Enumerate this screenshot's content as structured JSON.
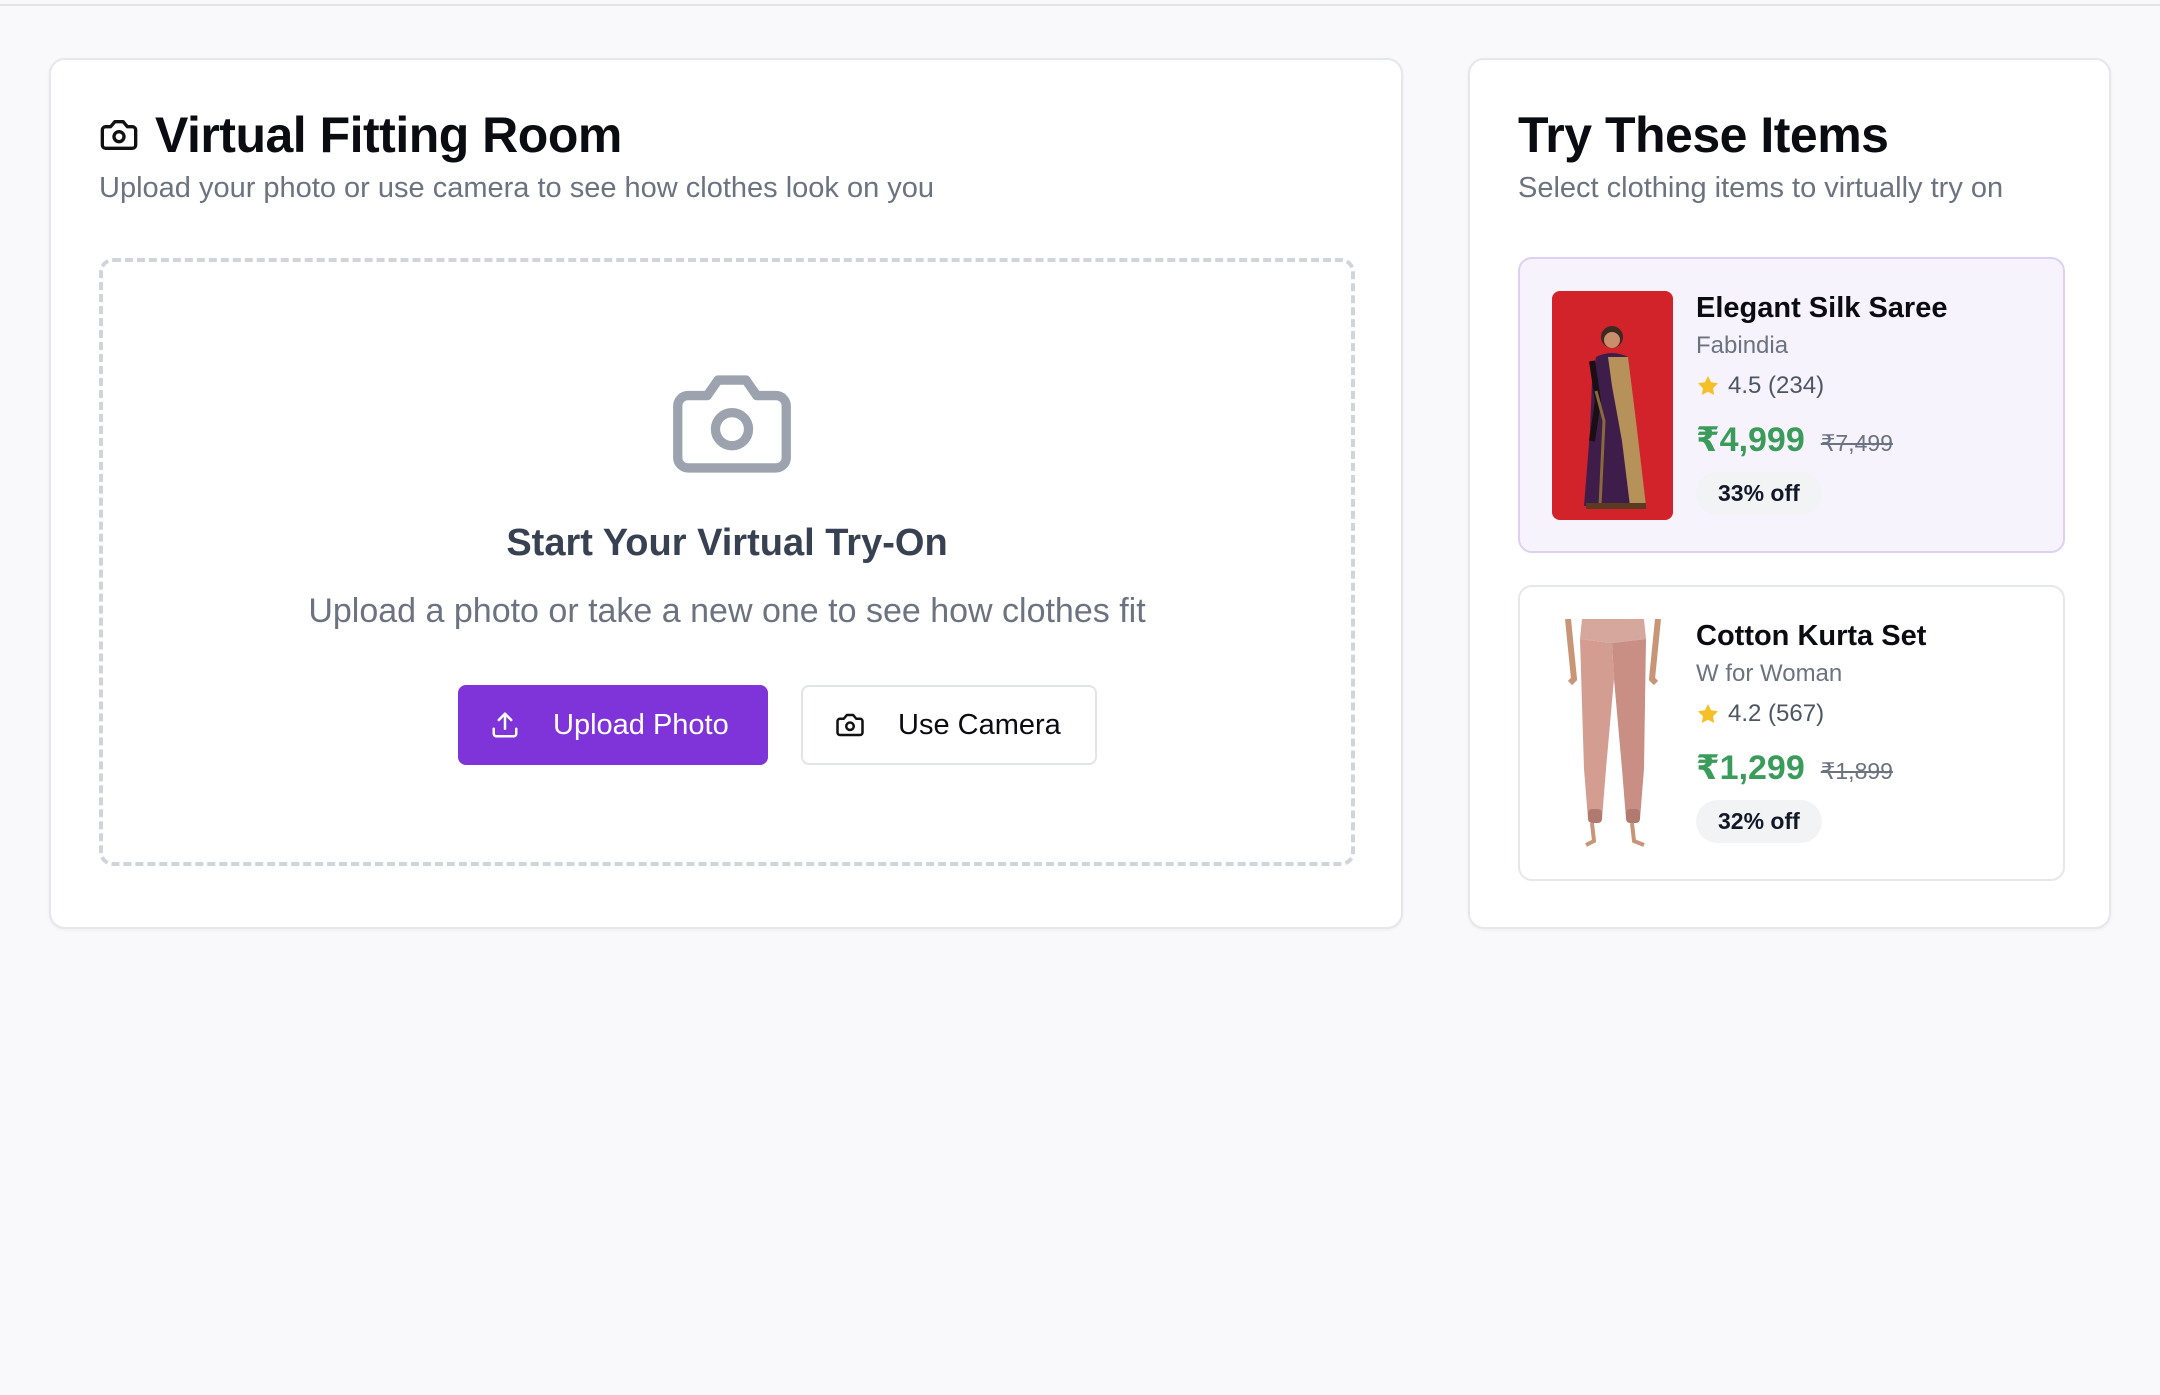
{
  "fitting_room": {
    "title": "Virtual Fitting Room",
    "subtitle": "Upload your photo or use camera to see how clothes look on you",
    "dropzone": {
      "title": "Start Your Virtual Try-On",
      "subtitle": "Upload a photo or take a new one to see how clothes fit",
      "upload_label": "Upload Photo",
      "camera_label": "Use Camera"
    }
  },
  "items_panel": {
    "title": "Try These Items",
    "subtitle": "Select clothing items to virtually try on",
    "products": [
      {
        "name": "Elegant Silk Saree",
        "brand": "Fabindia",
        "rating": "4.5 (234)",
        "price": "₹4,999",
        "mrp": "₹7,499",
        "discount": "33% off",
        "selected": true
      },
      {
        "name": "Cotton Kurta Set",
        "brand": "W for Woman",
        "rating": "4.2 (567)",
        "price": "₹1,299",
        "mrp": "₹1,899",
        "discount": "32% off",
        "selected": false
      }
    ]
  },
  "colors": {
    "accent": "#7e34d8",
    "price_green": "#3a9b5a",
    "star": "#f5c026",
    "selected_bg": "#f7f3fd"
  }
}
